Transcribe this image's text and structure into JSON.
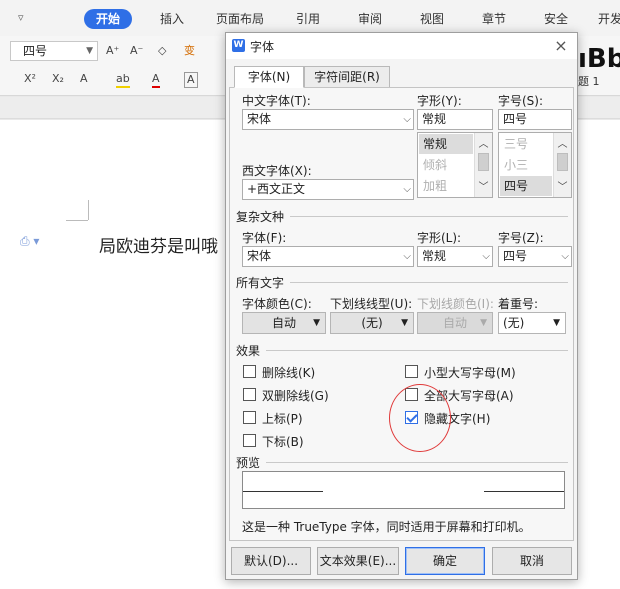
{
  "ribbon": {
    "quick_caret": "▿",
    "tabs": [
      "开始",
      "插入",
      "页面布局",
      "引用",
      "审阅",
      "视图",
      "章节",
      "安全",
      "开发"
    ],
    "font_size": "四号",
    "icons": {
      "grow": "A⁺",
      "shrink": "A⁻",
      "clear": "◇",
      "pinyin": "变",
      "super": "X²",
      "sub": "X₂",
      "effect": "A",
      "highlight": "ab",
      "color": "A",
      "border": "A"
    },
    "style_preview": "ıBbA",
    "style_label": "题 1"
  },
  "document": {
    "paragraph_icon": "⎙ ▾",
    "text": "局欧迪芬是叫哦"
  },
  "dialog": {
    "title": "字体",
    "close": "×",
    "tabs": {
      "font": "字体(N)",
      "spacing": "字符间距(R)"
    },
    "chinese_font": {
      "label": "中文字体(T):",
      "value": "宋体"
    },
    "style": {
      "label": "字形(Y):",
      "value": "常规",
      "options": [
        "常规",
        "倾斜",
        "加粗"
      ]
    },
    "size": {
      "label": "字号(S):",
      "value": "四号",
      "options": [
        "三号",
        "小三",
        "四号"
      ]
    },
    "western_font": {
      "label": "西文字体(X):",
      "value": "+西文正文"
    },
    "complex": {
      "title": "复杂文种",
      "font_label": "字体(F):",
      "font_value": "宋体",
      "style_label": "字形(L):",
      "style_value": "常规",
      "size_label": "字号(Z):",
      "size_value": "四号"
    },
    "all_text": {
      "title": "所有文字",
      "color_label": "字体颜色(C):",
      "color_value": "自动",
      "underline_label": "下划线线型(U):",
      "underline_value": "(无)",
      "underline_color_label": "下划线颜色(I):",
      "underline_color_value": "自动",
      "emphasis_label": "着重号:",
      "emphasis_value": "(无)"
    },
    "effects": {
      "title": "效果",
      "strikethrough": "删除线(K)",
      "double_strikethrough": "双删除线(G)",
      "superscript": "上标(P)",
      "subscript": "下标(B)",
      "small_caps": "小型大写字母(M)",
      "all_caps": "全部大写字母(A)",
      "hidden": "隐藏文字(H)"
    },
    "preview_title": "预览",
    "note": "这是一种 TrueType 字体，同时适用于屏幕和打印机。",
    "buttons": {
      "default": "默认(D)...",
      "text_effects": "文本效果(E)...",
      "ok": "确定",
      "cancel": "取消"
    }
  },
  "colors": {
    "accent": "#2f6fe6",
    "annotation": "#e03a3a"
  }
}
